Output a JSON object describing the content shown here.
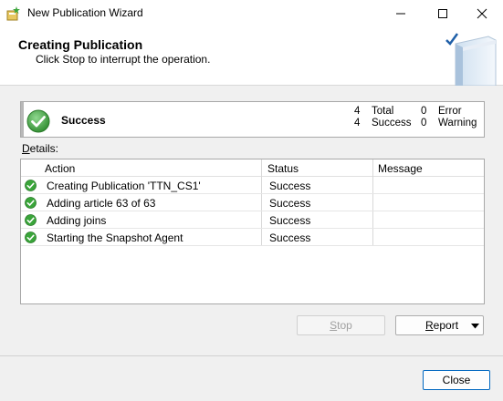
{
  "window": {
    "title": "New Publication Wizard",
    "minimize_icon": "minimize-icon",
    "maximize_icon": "maximize-icon",
    "close_icon": "close-icon"
  },
  "header": {
    "title": "Creating Publication",
    "subtitle": "Click Stop to interrupt the operation."
  },
  "summary": {
    "status": "Success",
    "total_count": "4",
    "total_label": "Total",
    "success_count": "4",
    "success_label": "Success",
    "error_count": "0",
    "error_label": "Error",
    "warning_count": "0",
    "warning_label": "Warning"
  },
  "details": {
    "label_prefix": "D",
    "label_rest": "etails:",
    "columns": {
      "action": "Action",
      "status": "Status",
      "message": "Message"
    },
    "rows": [
      {
        "action": "Creating Publication 'TTN_CS1'",
        "status": "Success",
        "message": ""
      },
      {
        "action": "Adding article 63 of 63",
        "status": "Success",
        "message": ""
      },
      {
        "action": "Adding joins",
        "status": "Success",
        "message": ""
      },
      {
        "action": "Starting the Snapshot Agent",
        "status": "Success",
        "message": ""
      }
    ]
  },
  "buttons": {
    "stop_prefix": "S",
    "stop_rest": "top",
    "report_prefix": "R",
    "report_rest": "eport",
    "close": "Close"
  },
  "colors": {
    "success_green": "#3aa53a",
    "accent_blue": "#0067c0"
  }
}
